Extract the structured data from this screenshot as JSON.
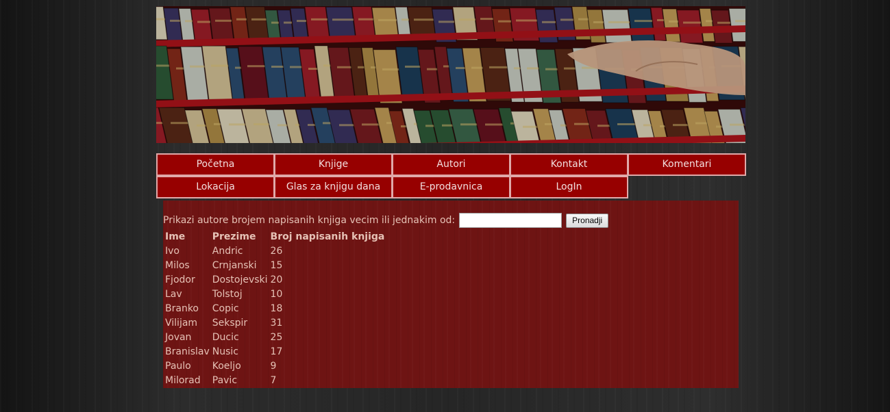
{
  "banner": {
    "alt": "books on a shelf"
  },
  "nav": {
    "row1": [
      "Početna",
      "Knjige",
      "Autori",
      "Kontakt",
      "Komentari"
    ],
    "row2": [
      "Lokacija",
      "Glas za knjigu dana",
      "E-prodavnica",
      "LogIn"
    ]
  },
  "search": {
    "label": "Prikazi autore brojem napisanih knjiga vecim ili jednakim od:",
    "value": "",
    "button_label": "Pronadji"
  },
  "table": {
    "headers": [
      "Ime",
      "Prezime",
      "Broj napisanih knjiga"
    ],
    "rows": [
      [
        "Ivo",
        "Andric",
        "26"
      ],
      [
        "Milos",
        "Crnjanski",
        "15"
      ],
      [
        "Fjodor",
        "Dostojevski",
        "20"
      ],
      [
        "Lav",
        "Tolstoj",
        "10"
      ],
      [
        "Branko",
        "Copic",
        "18"
      ],
      [
        "Vilijam",
        "Sekspir",
        "31"
      ],
      [
        "Jovan",
        "Ducic",
        "25"
      ],
      [
        "Branislav",
        "Nusic",
        "17"
      ],
      [
        "Paulo",
        "Koeljo",
        "9"
      ],
      [
        "Milorad",
        "Pavic",
        "7"
      ]
    ]
  },
  "colors": {
    "nav_bg": "#970000",
    "content_bg": "#6e1413",
    "text": "#e6c2b6"
  }
}
